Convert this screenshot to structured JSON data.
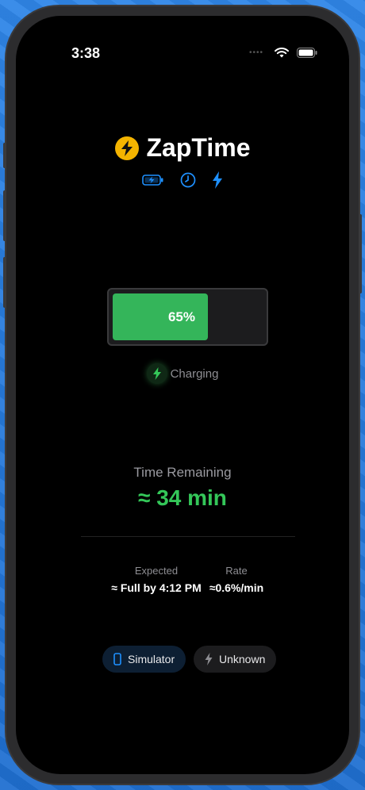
{
  "status_bar": {
    "time": "3:38"
  },
  "app": {
    "title": "ZapTime"
  },
  "battery": {
    "level_percent": 65,
    "label": "65%",
    "fill_color": "#34b55a"
  },
  "charging": {
    "label": "Charging"
  },
  "remaining": {
    "label": "Time Remaining",
    "value": "≈ 34 min",
    "color": "#34c759"
  },
  "stats": {
    "expected": {
      "label": "Expected",
      "value": "≈ Full by 4:12 PM"
    },
    "rate": {
      "label": "Rate",
      "value": "≈0.6%/min"
    }
  },
  "chips": {
    "simulator": {
      "label": "Simulator",
      "icon": "phone-icon"
    },
    "unknown": {
      "label": "Unknown",
      "icon": "bolt-icon"
    }
  },
  "icons": [
    "battery-charging-icon",
    "clock-icon",
    "bolt-icon"
  ],
  "colors": {
    "accent_blue": "#1e90ff",
    "brand_yellow": "#f4b400",
    "green": "#34c759"
  }
}
